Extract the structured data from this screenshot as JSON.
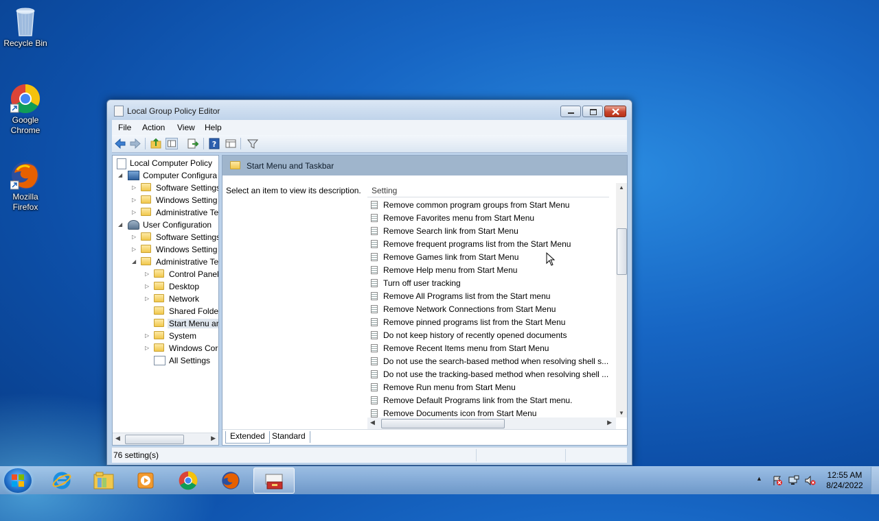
{
  "desktop": {
    "icons": [
      {
        "label": "Recycle Bin"
      },
      {
        "label": "Google\nChrome"
      },
      {
        "label": "Mozilla\nFirefox"
      }
    ]
  },
  "window": {
    "title": "Local Group Policy Editor",
    "menu": [
      "File",
      "Action",
      "View",
      "Help"
    ],
    "tree": [
      {
        "label": "Local Computer Policy"
      },
      {
        "label": "Computer Configura"
      },
      {
        "label": "Software Settings"
      },
      {
        "label": "Windows Setting"
      },
      {
        "label": "Administrative Te"
      },
      {
        "label": "User Configuration"
      },
      {
        "label": "Software Settings"
      },
      {
        "label": "Windows Setting"
      },
      {
        "label": "Administrative Te"
      },
      {
        "label": "Control Panel"
      },
      {
        "label": "Desktop"
      },
      {
        "label": "Network"
      },
      {
        "label": "Shared Folder"
      },
      {
        "label": "Start Menu ar"
      },
      {
        "label": "System"
      },
      {
        "label": "Windows Cor"
      },
      {
        "label": "All Settings"
      }
    ],
    "pane_header": "Start Menu and Taskbar",
    "description": "Select an item to view its description.",
    "column_header": "Setting",
    "settings": [
      "Remove common program groups from Start Menu",
      "Remove Favorites menu from Start Menu",
      "Remove Search link from Start Menu",
      "Remove frequent programs list from the Start Menu",
      "Remove Games link from Start Menu",
      "Remove Help menu from Start Menu",
      "Turn off user tracking",
      "Remove All Programs list from the Start menu",
      "Remove Network Connections from Start Menu",
      "Remove pinned programs list from the Start Menu",
      "Do not keep history of recently opened documents",
      "Remove Recent Items menu from Start Menu",
      "Do not use the search-based method when resolving shell s...",
      "Do not use the tracking-based method when resolving shell ...",
      "Remove Run menu from Start Menu",
      "Remove Default Programs link from the Start menu.",
      "Remove Documents icon from Start Menu"
    ],
    "tabs": [
      "Extended",
      "Standard"
    ],
    "status": "76 setting(s)"
  },
  "taskbar": {
    "time": "12:55 AM",
    "date": "8/24/2022"
  }
}
